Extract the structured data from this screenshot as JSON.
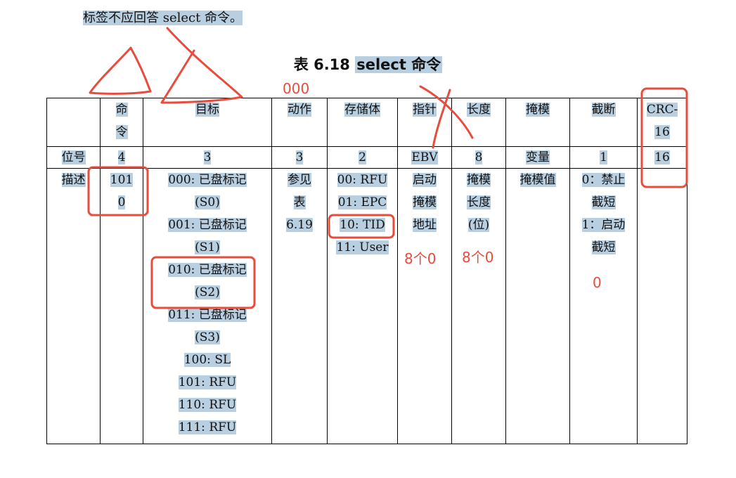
{
  "intro_text": "标签不应回答 select 命令。",
  "table_title": {
    "prefix": "表 6.18 ",
    "name": "select 命令"
  },
  "table": {
    "header_row": [
      {
        "label_lines": [
          ""
        ]
      },
      {
        "label_lines": [
          "命",
          "令"
        ]
      },
      {
        "label_lines": [
          "目标"
        ]
      },
      {
        "label_lines": [
          "动作"
        ]
      },
      {
        "label_lines": [
          "存储体"
        ]
      },
      {
        "label_lines": [
          "指针"
        ]
      },
      {
        "label_lines": [
          "长度"
        ]
      },
      {
        "label_lines": [
          "掩模"
        ]
      },
      {
        "label_lines": [
          "截断"
        ]
      },
      {
        "label_lines": [
          "CRC-",
          "16"
        ]
      }
    ],
    "bits_row": [
      "位号",
      "4",
      "3",
      "3",
      "2",
      "EBV",
      "8",
      "变量",
      "1",
      "16"
    ],
    "desc_row": [
      {
        "lines": [
          "描述"
        ]
      },
      {
        "lines": [
          "101",
          "0"
        ]
      },
      {
        "lines": [
          "000: 已盘标记",
          "(S0)",
          "001: 已盘标记",
          "(S1)",
          "010: 已盘标记",
          "(S2)",
          "011: 已盘标记",
          "(S3)",
          "100: SL",
          "101: RFU",
          "110: RFU",
          "111: RFU"
        ]
      },
      {
        "lines": [
          "参见",
          "表",
          "6.19"
        ]
      },
      {
        "lines": [
          "00: RFU",
          "01: EPC",
          "10: TID",
          "11: User"
        ]
      },
      {
        "lines": [
          "启动",
          "掩模",
          "地址"
        ]
      },
      {
        "lines": [
          "掩模",
          "长度",
          "(位)"
        ]
      },
      {
        "lines": [
          "掩模值"
        ]
      },
      {
        "lines": [
          "0：禁止",
          "截短",
          "1：启动",
          "截短"
        ]
      },
      {
        "lines": [
          ""
        ]
      }
    ]
  },
  "annotations": {
    "action_value": "000",
    "pointer_value": "8个0",
    "length_value": "8个0",
    "truncate_value": "0"
  },
  "colors": {
    "highlight": "#b7cfe1",
    "annotation_red": "#e74c3c"
  }
}
